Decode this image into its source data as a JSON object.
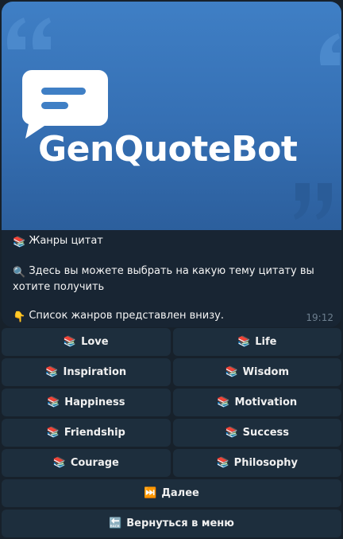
{
  "banner": {
    "logo_text": "GenQuoteBot"
  },
  "message": {
    "line1": "Жанры цитат",
    "line2": "Здесь вы можете выбрать на какую тему цитату вы хотите получить",
    "line3": "Список жанров представлен внизу.",
    "time": "19:12"
  },
  "icons": {
    "books": "books-icon",
    "magnifier": "magnifier-icon",
    "pointing_down": "pointing-down-hand-icon",
    "next_track": "next-track-icon",
    "back_arrow": "back-arrow-icon"
  },
  "keyboard": {
    "genres": [
      "Love",
      "Life",
      "Inspiration",
      "Wisdom",
      "Happiness",
      "Motivation",
      "Friendship",
      "Success",
      "Courage",
      "Philosophy"
    ],
    "next_label": "Далее",
    "back_label": "Вернуться в меню"
  },
  "colors": {
    "background": "#17212b",
    "bubble": "#182533",
    "button": "#1d2e3d",
    "banner": "#3f7fc5"
  }
}
